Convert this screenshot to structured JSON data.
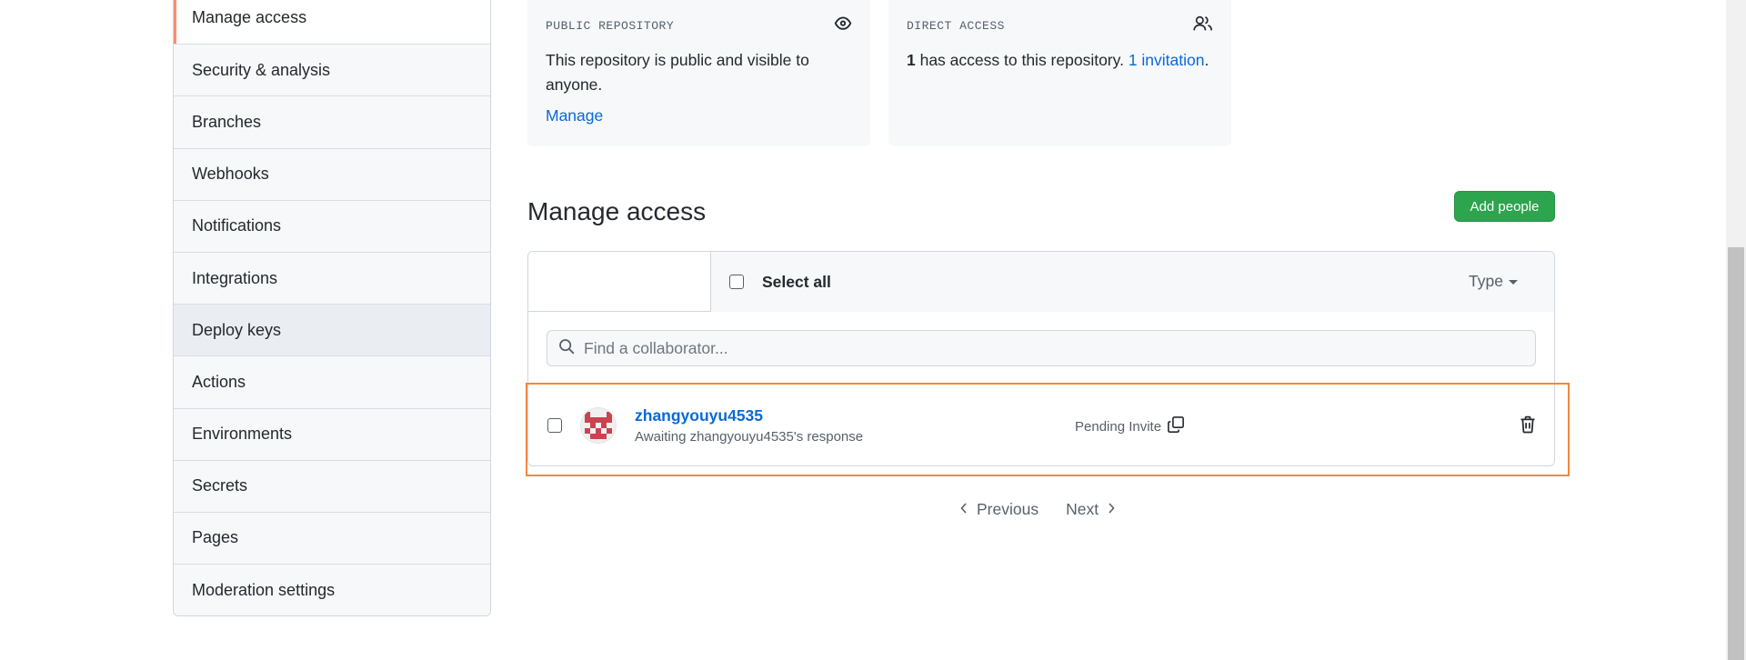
{
  "sidebar": {
    "items": [
      {
        "label": "Manage access"
      },
      {
        "label": "Security & analysis"
      },
      {
        "label": "Branches"
      },
      {
        "label": "Webhooks"
      },
      {
        "label": "Notifications"
      },
      {
        "label": "Integrations"
      },
      {
        "label": "Deploy keys"
      },
      {
        "label": "Actions"
      },
      {
        "label": "Environments"
      },
      {
        "label": "Secrets"
      },
      {
        "label": "Pages"
      },
      {
        "label": "Moderation settings"
      }
    ]
  },
  "cards": {
    "public": {
      "title": "PUBLIC REPOSITORY",
      "text": "This repository is public and visible to anyone.",
      "link": "Manage",
      "icon": "eye-icon"
    },
    "direct": {
      "title": "DIRECT ACCESS",
      "count": "1",
      "text": " has access to this repository. ",
      "link": "1 invitation",
      "suffix": ".",
      "icon": "people-icon"
    }
  },
  "manage": {
    "title": "Manage access",
    "add_button": "Add people",
    "select_all": "Select all",
    "type_filter": "Type",
    "search_placeholder": "Find a collaborator..."
  },
  "collaborators": [
    {
      "username": "zhangyouyu4535",
      "subtitle": "Awaiting zhangyouyu4535's response",
      "status": "Pending Invite"
    }
  ],
  "pagination": {
    "previous": "Previous",
    "next": "Next"
  },
  "colors": {
    "accent_link": "#0969da",
    "button_green": "#2da44e",
    "highlight_orange": "#f0883e",
    "avatar_red": "#c9444f"
  }
}
